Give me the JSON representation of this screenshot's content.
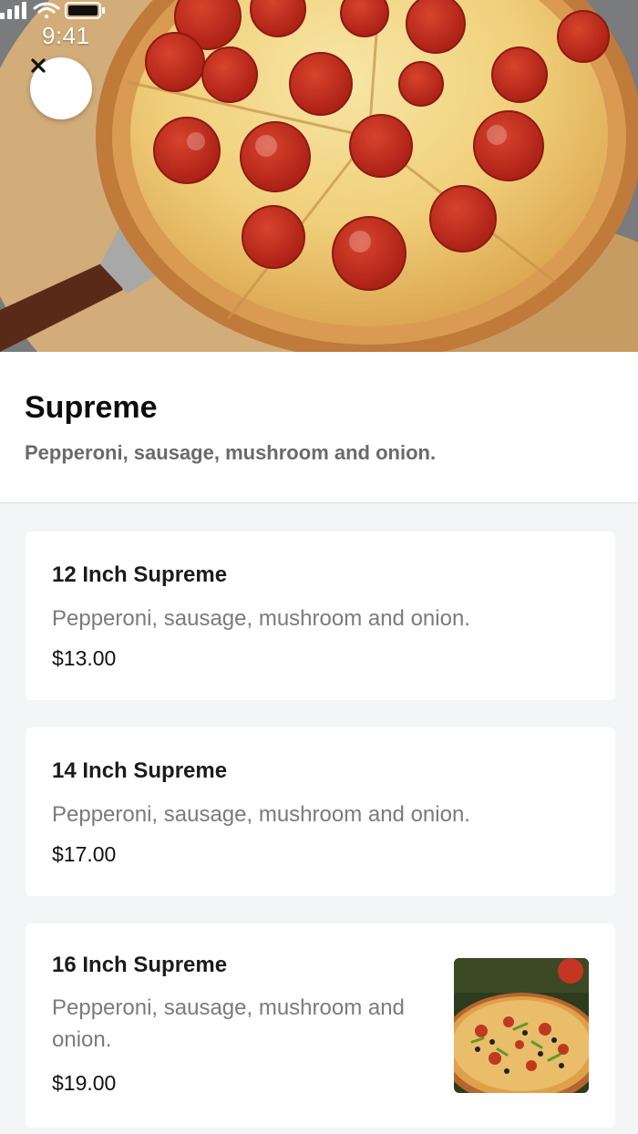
{
  "status_bar": {
    "time": "9:41",
    "icons": [
      "signal-icon",
      "wifi-icon",
      "battery-icon"
    ]
  },
  "hero": {
    "image": "pepperoni-pizza-photo",
    "close_icon": "close-icon"
  },
  "item": {
    "title": "Supreme",
    "subtitle": "Pepperoni, sausage, mushroom and onion."
  },
  "options": [
    {
      "title": "12 Inch Supreme",
      "description": "Pepperoni, sausage, mushroom and onion.",
      "price": "$13.00"
    },
    {
      "title": "14 Inch Supreme",
      "description": "Pepperoni, sausage, mushroom and onion.",
      "price": "$17.00"
    },
    {
      "title": "16 Inch Supreme",
      "description": "Pepperoni, sausage, mushroom and onion.",
      "price": "$19.00",
      "thumbnail": "supreme-pizza-thumbnail"
    }
  ],
  "colors": {
    "background": "#f4f5f7",
    "card": "#ffffff",
    "text_primary": "#111111",
    "text_secondary": "#7b7b7b"
  }
}
